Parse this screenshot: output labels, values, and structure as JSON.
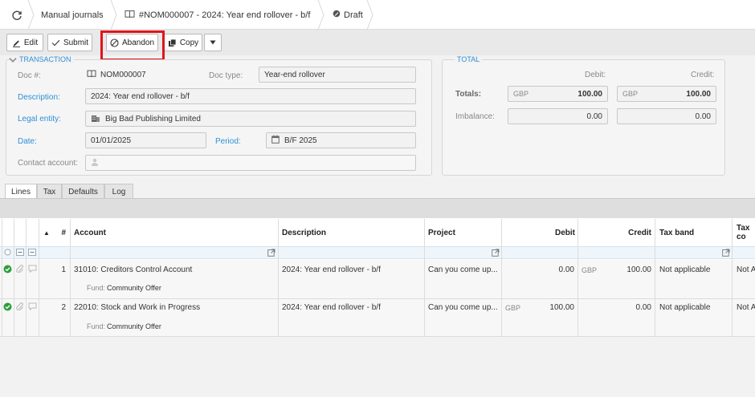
{
  "breadcrumb": {
    "module": "Manual journals",
    "document": "#NOM000007 - 2024: Year end rollover - b/f",
    "status": "Draft"
  },
  "toolbar": {
    "edit": "Edit",
    "submit": "Submit",
    "abandon": "Abandon",
    "copy": "Copy"
  },
  "transaction": {
    "legend": "TRANSACTION",
    "doc_label": "Doc #:",
    "doc_value": "NOM000007",
    "doctype_label": "Doc type:",
    "doctype_value": "Year-end rollover",
    "description_label": "Description:",
    "description_value": "2024: Year end rollover - b/f",
    "legal_entity_label": "Legal entity:",
    "legal_entity_value": "Big Bad Publishing Limited",
    "date_label": "Date:",
    "date_value": "01/01/2025",
    "period_label": "Period:",
    "period_value": "B/F 2025",
    "contact_label": "Contact account:",
    "contact_value": ""
  },
  "total": {
    "legend": "TOTAL",
    "debit_header": "Debit:",
    "credit_header": "Credit:",
    "totals_label": "Totals:",
    "imbalance_label": "Imbalance:",
    "currency": "GBP",
    "totals_debit": "100.00",
    "totals_credit": "100.00",
    "imbalance_debit": "0.00",
    "imbalance_credit": "0.00"
  },
  "tabs": [
    "Lines",
    "Tax",
    "Defaults",
    "Log"
  ],
  "grid": {
    "sort_indicator": "▲",
    "columns": {
      "num": "#",
      "account": "Account",
      "description": "Description",
      "project": "Project",
      "debit": "Debit",
      "credit": "Credit",
      "tax_band": "Tax band",
      "tax_code": "Tax co"
    },
    "fund_label": "Fund:",
    "rows": [
      {
        "num": "1",
        "account": "31010: Creditors Control Account",
        "description": "2024: Year end rollover - b/f",
        "project": "Can you come up...",
        "debit_currency": "",
        "debit": "0.00",
        "credit_currency": "GBP",
        "credit": "100.00",
        "tax_band": "Not applicable",
        "tax_code": "Not A",
        "fund": "Community Offer"
      },
      {
        "num": "2",
        "account": "22010: Stock and Work in Progress",
        "description": "2024: Year end rollover - b/f",
        "project": "Can you come up...",
        "debit_currency": "GBP",
        "debit": "100.00",
        "credit_currency": "",
        "credit": "0.00",
        "tax_band": "Not applicable",
        "tax_code": "Not A",
        "fund": "Community Offer"
      }
    ]
  },
  "colors": {
    "accent_blue": "#2f8fd8",
    "highlight_red": "#e1141c",
    "status_green": "#2e9e3e"
  }
}
